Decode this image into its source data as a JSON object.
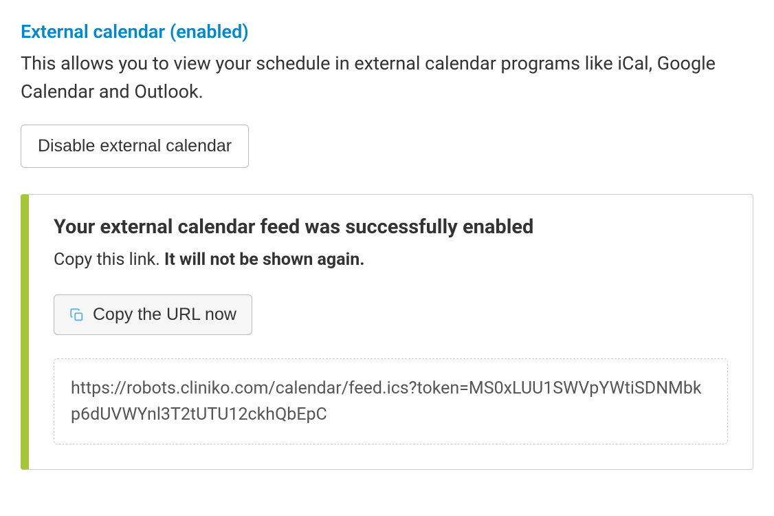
{
  "section": {
    "heading": "External calendar (enabled)",
    "description": "This allows you to view your schedule in external calendar programs like iCal, Google Calendar and Outlook.",
    "disable_button": "Disable external calendar"
  },
  "panel": {
    "title": "Your external calendar feed was successfully enabled",
    "subtext_prefix": "Copy this link. ",
    "subtext_bold": "It will not be shown again.",
    "copy_button": "Copy the URL now",
    "url": "https://robots.cliniko.com/calendar/feed.ics?token=MS0xLUU1SWVpYWtiSDNMbkp6dUVWYnl3T2tUTU12ckhQbEpC"
  }
}
